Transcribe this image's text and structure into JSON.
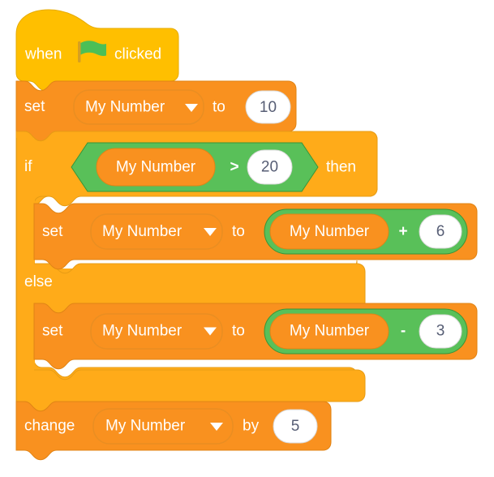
{
  "palette": {
    "event_yellow": "#ffbf00",
    "event_yellow_stroke": "#e6ab00",
    "variable_orange": "#f9911f",
    "variable_orange_stroke": "#e08416",
    "control_gold": "#ffab19",
    "control_gold_stroke": "#e79c15",
    "operator_green": "#59c059",
    "operator_green_stroke": "#389438",
    "field_white": "#ffffff",
    "field_white_stroke": "#d8d8d8",
    "text_white": "#ffffff",
    "text_dark": "#575e75",
    "flag_green": "#4cbf56",
    "flag_pole": "#d6a021",
    "canvas": "#ffffff"
  },
  "script": {
    "title": "Scratch variable script",
    "blocks": [
      {
        "id": "hat",
        "kind": "hat-block",
        "category": "events",
        "opcode": "event_whenflagclicked",
        "label_before": "when",
        "icon": "green-flag-icon",
        "label_after": "clicked"
      },
      {
        "id": "set-1",
        "kind": "stack-block",
        "category": "variables",
        "opcode": "data_setvariableto",
        "label_before": "set",
        "variable": "My Number",
        "dropdown_icon": "chevron-down-icon",
        "label_middle": "to",
        "value": "10"
      },
      {
        "id": "if-else",
        "kind": "c-block-if-else",
        "category": "control",
        "opcode": "control_if_else",
        "label_if": "if",
        "label_then": "then",
        "label_else": "else",
        "condition": {
          "id": "gt",
          "kind": "boolean-block",
          "category": "operators",
          "opcode": "operator_gt",
          "left_variable": "My Number",
          "operator": ">",
          "right_value": "20"
        },
        "branch_if": [
          {
            "id": "set-2",
            "kind": "stack-block",
            "category": "variables",
            "opcode": "data_setvariableto",
            "label_before": "set",
            "variable": "My Number",
            "dropdown_icon": "chevron-down-icon",
            "label_middle": "to",
            "reporter": {
              "id": "add",
              "kind": "reporter-block",
              "category": "operators",
              "opcode": "operator_add",
              "left_variable": "My Number",
              "operator": "+",
              "right_value": "6"
            }
          }
        ],
        "branch_else": [
          {
            "id": "set-3",
            "kind": "stack-block",
            "category": "variables",
            "opcode": "data_setvariableto",
            "label_before": "set",
            "variable": "My Number",
            "dropdown_icon": "chevron-down-icon",
            "label_middle": "to",
            "reporter": {
              "id": "subtract",
              "kind": "reporter-block",
              "category": "operators",
              "opcode": "operator_subtract",
              "left_variable": "My Number",
              "operator": "-",
              "right_value": "3"
            }
          }
        ]
      },
      {
        "id": "change-1",
        "kind": "stack-block",
        "category": "variables",
        "opcode": "data_changevariableby",
        "label_before": "change",
        "variable": "My Number",
        "dropdown_icon": "chevron-down-icon",
        "label_middle": "by",
        "value": "5"
      }
    ]
  },
  "text": {
    "when": "when",
    "clicked": "clicked",
    "set": "set",
    "to": "to",
    "by": "by",
    "change": "change",
    "if": "if",
    "then": "then",
    "else": "else",
    "my_number": "My Number",
    "val_10": "10",
    "val_20": "20",
    "val_6": "6",
    "val_3": "3",
    "val_5": "5",
    "op_gt": ">",
    "op_plus": "+",
    "op_minus": "-"
  }
}
